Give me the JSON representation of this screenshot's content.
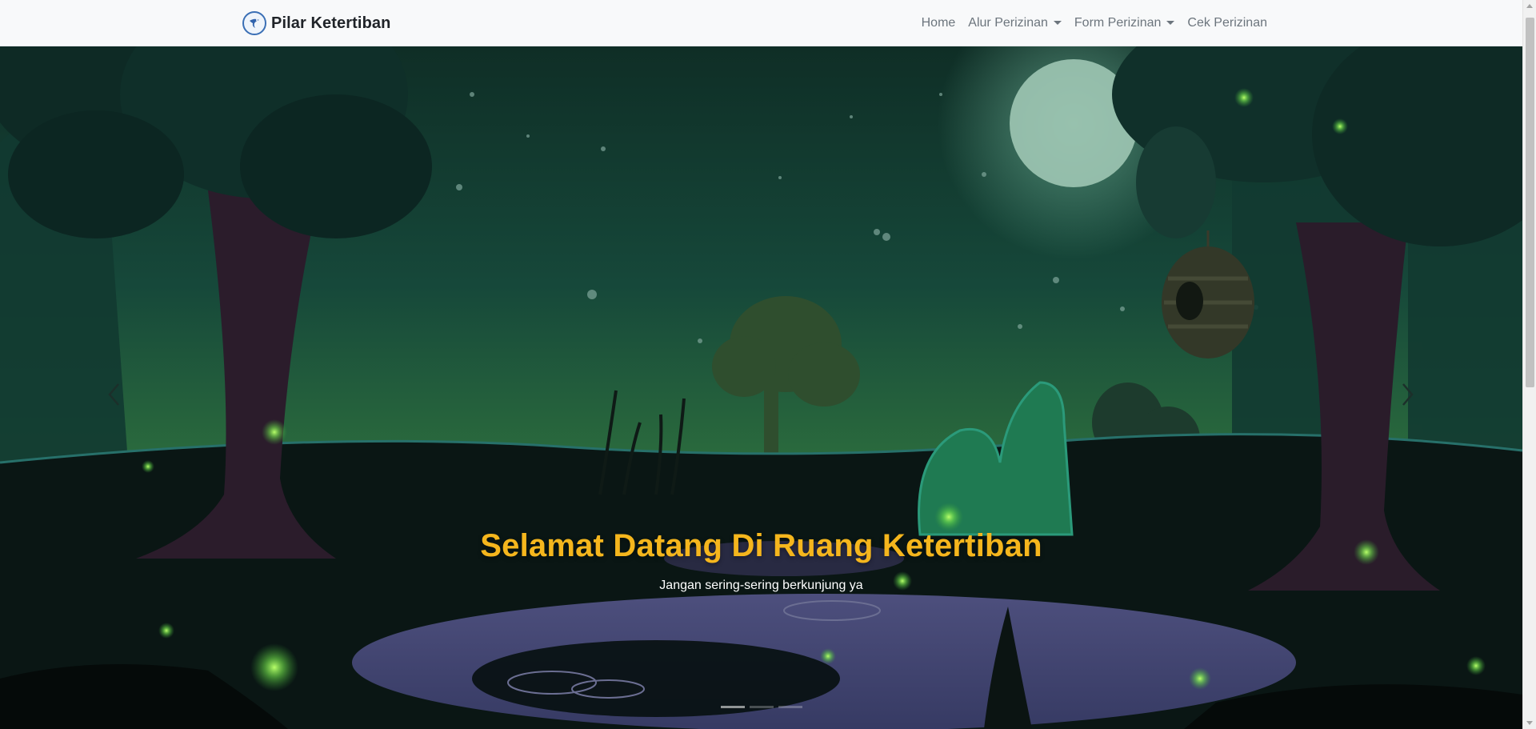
{
  "navbar": {
    "brand": "Pilar Ketertiban",
    "items": [
      {
        "label": "Home",
        "dropdown": false
      },
      {
        "label": "Alur Perizinan",
        "dropdown": true
      },
      {
        "label": "Form Perizinan",
        "dropdown": true
      },
      {
        "label": "Cek Perizinan",
        "dropdown": false
      }
    ]
  },
  "hero": {
    "title": "Selamat Datang Di Ruang Ketertiban",
    "subtitle": "Jangan sering-sering berkunjung ya",
    "indicators": 3,
    "active_indicator": 1
  },
  "colors": {
    "title": "#f5b61d",
    "brand_icon": "#3a6fb5",
    "nav_text": "#6c757d"
  },
  "icons": {
    "brand": "bird-logo-icon",
    "prev": "chevron-left-icon",
    "next": "chevron-right-icon",
    "dropdown": "caret-down-icon"
  }
}
